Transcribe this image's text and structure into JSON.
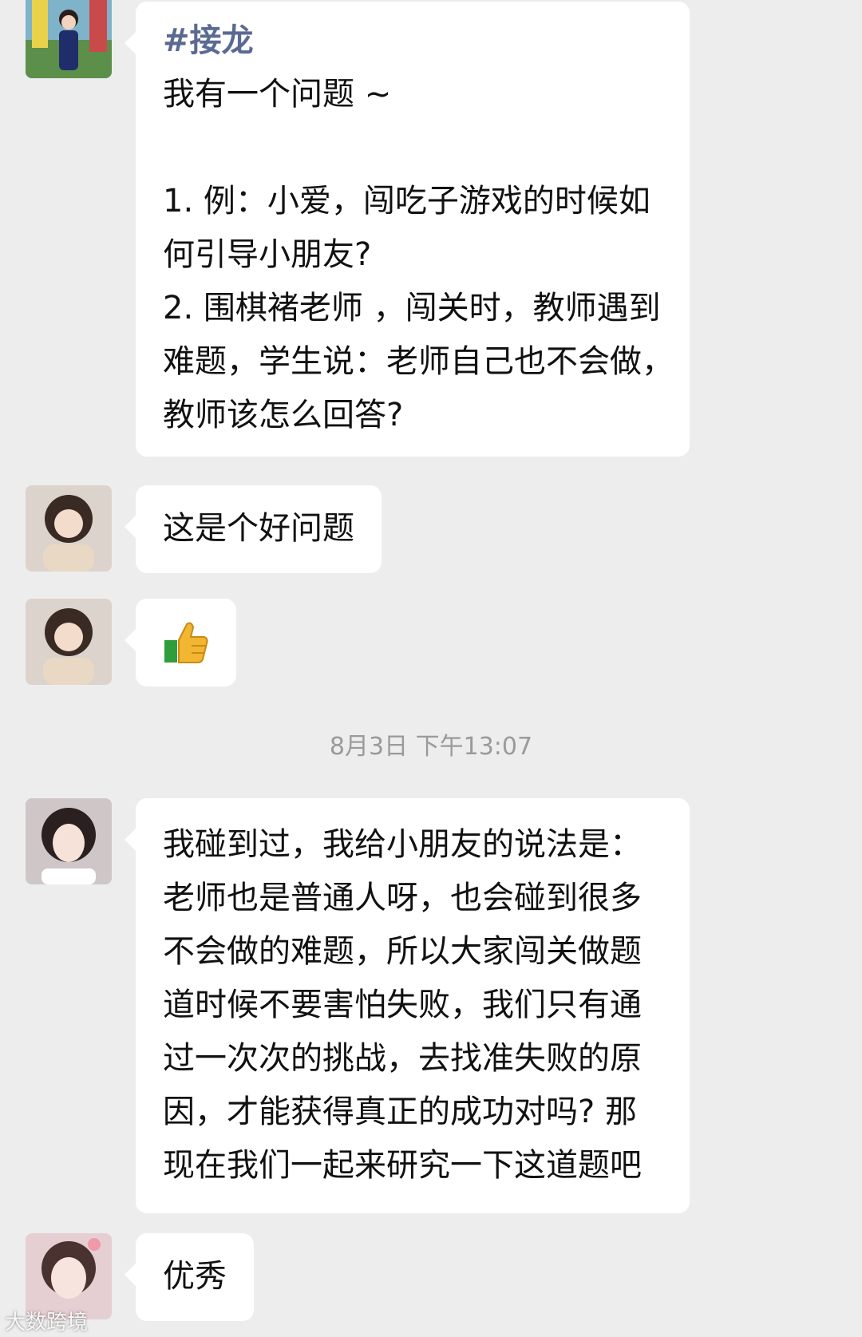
{
  "messages": [
    {
      "tag": "#接龙",
      "lines": [
        "我有一个问题 ~",
        "",
        "1. 例：小爱，闯吃子游戏的时候如",
        "何引导小朋友?",
        "2. 围棋褚老师 ，闯关时，教师遇到",
        "难题，学生说：老师自己也不会做，",
        "教师该怎么回答?"
      ]
    },
    {
      "lines": [
        "这是个好问题"
      ]
    },
    {
      "emoji": "thumbs-up-icon"
    },
    {
      "lines": [
        "我碰到过，我给小朋友的说法是：",
        "老师也是普通人呀，也会碰到很多",
        "不会做的难题，所以大家闯关做题",
        "道时候不要害怕失败，我们只有通",
        "过一次次的挑战，去找准失败的原",
        "因，才能获得真正的成功对吗? 那",
        "现在我们一起来研究一下这道题吧"
      ]
    },
    {
      "lines": [
        "优秀"
      ]
    }
  ],
  "timestamp": "8月3日 下午13:07",
  "watermark": "大数跨境",
  "colors": {
    "background": "#ededed",
    "bubble": "#ffffff",
    "tag": "#5b6a92",
    "timestamp": "#9a9a9a"
  }
}
